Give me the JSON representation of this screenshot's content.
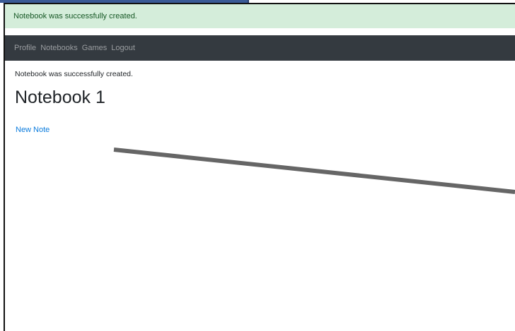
{
  "flash": {
    "message": "Notebook was successfully created."
  },
  "nav": {
    "items": [
      {
        "label": "Profile"
      },
      {
        "label": "Notebooks"
      },
      {
        "label": "Games"
      },
      {
        "label": "Logout"
      }
    ]
  },
  "main": {
    "notice": "Notebook was successfully created.",
    "title": "Notebook 1",
    "new_note_label": "New Note"
  },
  "colors": {
    "flash_bg": "#d4edda",
    "flash_text": "#155724",
    "navbar_bg": "#343a40",
    "link": "#0a7bdd",
    "annotation_stroke": "#666666"
  }
}
